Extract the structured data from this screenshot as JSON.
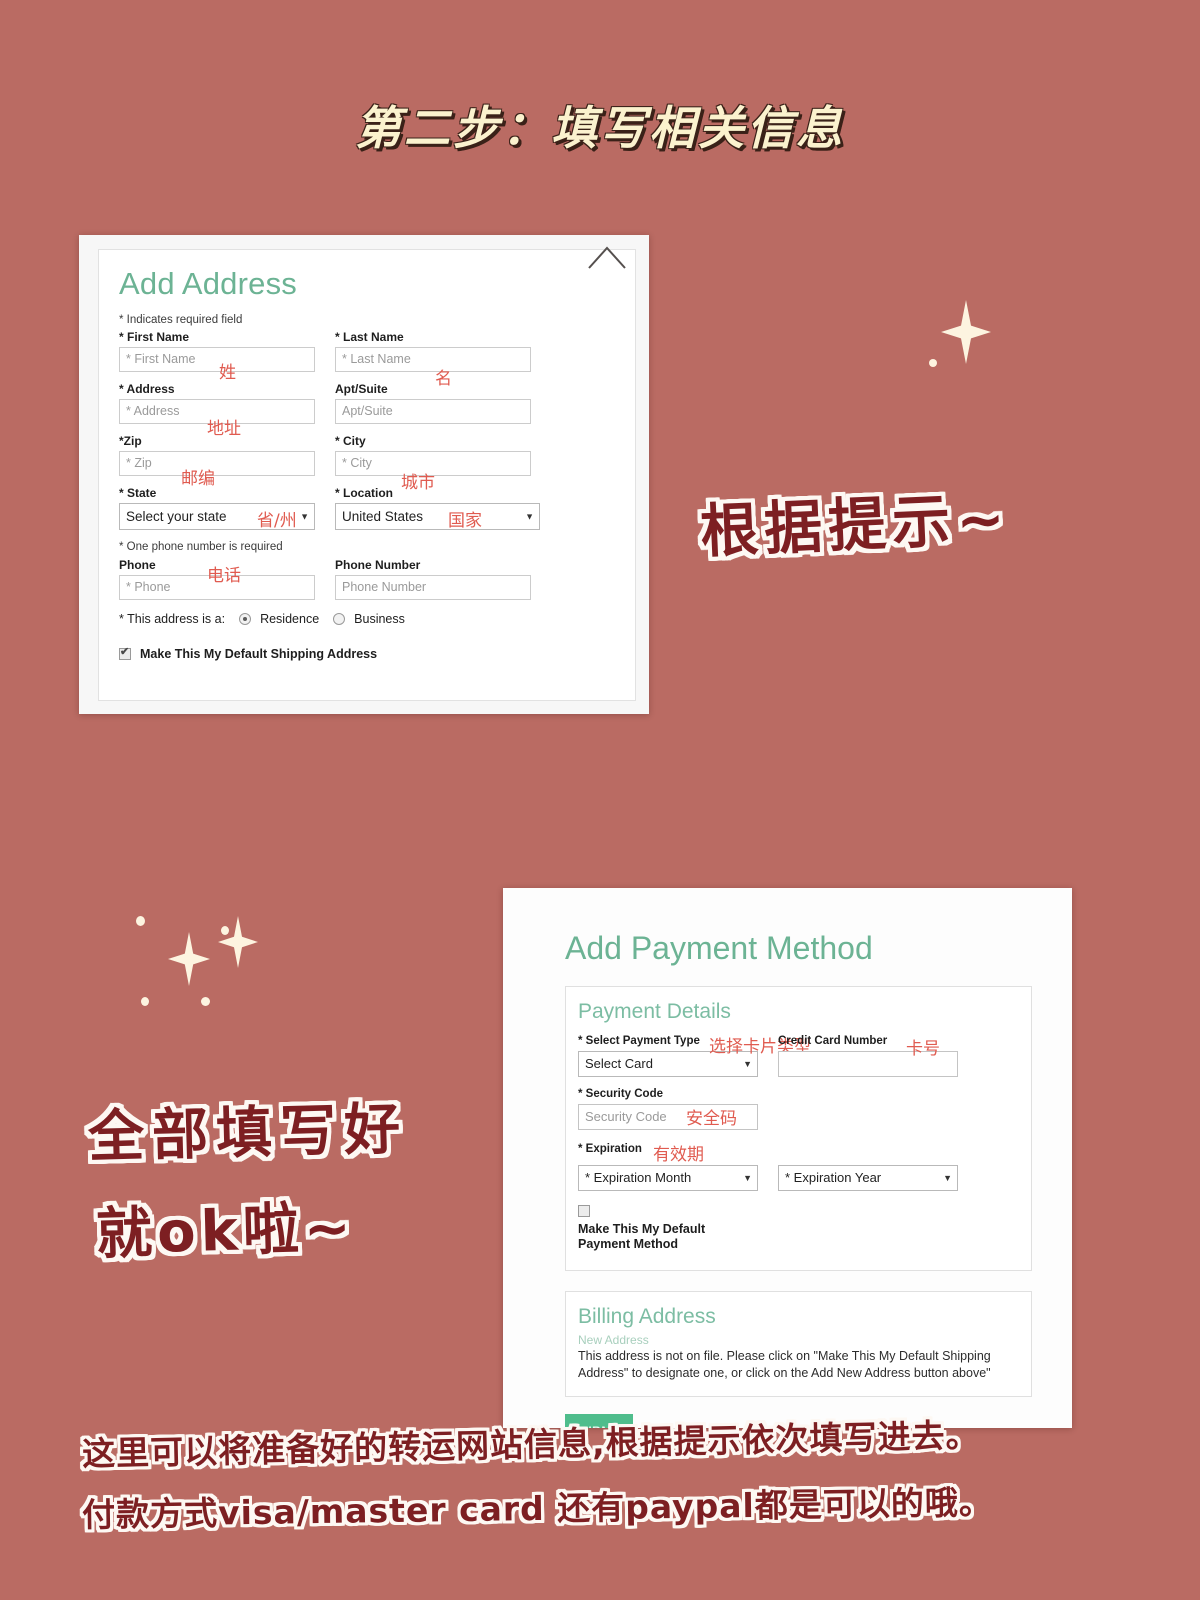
{
  "page": {
    "background_color": "#ba6b63",
    "title": "第二步：填写相关信息",
    "title_fill_color": "#fbf2ce",
    "title_outline_color": "#3a2118"
  },
  "annotations": {
    "hint": "根据提示~",
    "all_filled": "全部填写好",
    "then_ok": "就ok啦~",
    "bottom_line_1": "这里可以将准备好的转运网站信息,根据提示依次填写进去。",
    "bottom_line_2": "付款方式visa/master card 还有paypal都是可以的哦。",
    "ink_color": "#7d1f22",
    "outline_color": "#fdf8f3"
  },
  "address_form": {
    "heading": "Add Address",
    "heading_color": "#6cb394",
    "required_note": "* Indicates required field",
    "fields": {
      "first_name_label": "* First Name",
      "first_name_placeholder": "* First Name",
      "first_name_cn": "姓",
      "last_name_label": "* Last Name",
      "last_name_placeholder": "* Last Name",
      "last_name_cn": "名",
      "address_label": "* Address",
      "address_placeholder": "* Address",
      "address_cn": "地址",
      "apt_label": "Apt/Suite",
      "apt_placeholder": "Apt/Suite",
      "zip_label": "*Zip",
      "zip_placeholder": "* Zip",
      "zip_cn": "邮编",
      "city_label": "* City",
      "city_placeholder": "* City",
      "city_cn": "城市",
      "state_label": "* State",
      "state_value": "Select your state",
      "state_cn": "省/州",
      "location_label": "* Location",
      "location_value": "United States",
      "location_cn": "国家",
      "phone_note": "* One phone number is required",
      "phone_label": "Phone",
      "phone_placeholder": "* Phone",
      "phone_cn": "电话",
      "phone_number_label": "Phone Number",
      "phone_number_placeholder": "Phone Number"
    },
    "address_type_label": "* This address is a:",
    "address_type_options": [
      "Residence",
      "Business"
    ],
    "address_type_selected": "Residence",
    "default_shipping_label": "Make This My Default Shipping Address",
    "default_shipping_checked": true
  },
  "payment_form": {
    "heading": "Add Payment Method",
    "heading_color": "#6cb394",
    "payment_details": {
      "panel_heading": "Payment Details",
      "select_payment_type_label": "* Select Payment Type",
      "select_payment_type_cn": "选择卡片类型",
      "select_card_value": "Select Card",
      "credit_card_number_label": "Credit Card Number",
      "credit_card_number_cn": "卡号",
      "credit_card_number_value": "",
      "security_code_label": "* Security Code",
      "security_code_placeholder": "Security Code",
      "security_code_cn": "安全码",
      "expiration_label": "* Expiration",
      "expiration_cn": "有效期",
      "expiration_month_value": "* Expiration Month",
      "expiration_year_value": "* Expiration Year",
      "default_payment_label": "Make This My Default Payment Method",
      "default_payment_checked": false
    },
    "billing_address": {
      "panel_heading": "Billing Address",
      "sub_label": "New Address",
      "message": "This address is not on file. Please click on \"Make This My Default Shipping Address\" to designate one, or click on the Add New Address button above\""
    },
    "submit_label": "SUBMIT",
    "submit_color": "#4fbd8c"
  }
}
